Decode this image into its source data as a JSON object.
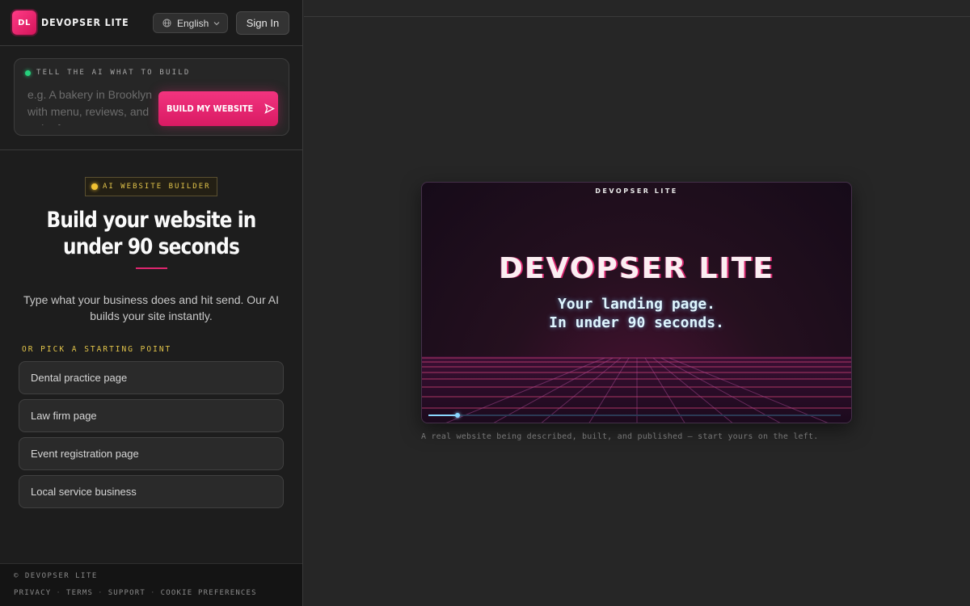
{
  "brand": {
    "logo_mark": "DL",
    "name": "DEVOPSER LITE",
    "accent": "#e6216f"
  },
  "header": {
    "language_label": "English",
    "language_icon": "globe-icon",
    "signin_label": "Sign In"
  },
  "prompt": {
    "label": "TELL THE AI WHAT TO BUILD",
    "placeholder": "e.g. A bakery in Brooklyn with menu, reviews, and order form",
    "button_label": "BUILD MY WEBSITE",
    "button_icon": "send-icon"
  },
  "hero": {
    "badge": "AI WEBSITE BUILDER",
    "title": "Build your website in under 90 seconds",
    "subtitle": "Type what your business does and hit send. Our AI builds your site instantly."
  },
  "starting_points": {
    "label": "OR PICK A STARTING POINT",
    "items": [
      {
        "label": "Dental practice page"
      },
      {
        "label": "Law firm page"
      },
      {
        "label": "Event registration page"
      },
      {
        "label": "Local service business"
      }
    ]
  },
  "footer": {
    "copyright": "© DEVOPSER LITE",
    "links": [
      {
        "label": "PRIVACY"
      },
      {
        "label": "TERMS"
      },
      {
        "label": "SUPPORT"
      },
      {
        "label": "COOKIE PREFERENCES"
      }
    ]
  },
  "preview": {
    "brand": "DEVOPSER LITE",
    "title": "DEVOPSER LITE",
    "subtitle_line1": "Your landing page.",
    "subtitle_line2": "In under 90 seconds.",
    "progress": 0.07,
    "caption": "A real website being described, built, and published — start yours on the left."
  }
}
